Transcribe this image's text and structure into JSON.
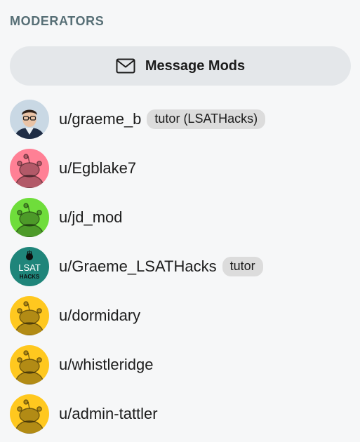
{
  "section": {
    "title": "MODERATORS"
  },
  "message_button": {
    "label": "Message Mods",
    "icon": "mail-icon"
  },
  "moderators": [
    {
      "username": "u/graeme_b",
      "flair": "tutor (LSATHacks)",
      "avatar": "photo",
      "avatar_color": "#c9d8e4"
    },
    {
      "username": "u/Egblake7",
      "flair": "",
      "avatar": "snoo",
      "avatar_color": "#ff8095"
    },
    {
      "username": "u/jd_mod",
      "flair": "",
      "avatar": "snoo",
      "avatar_color": "#6fdd3b"
    },
    {
      "username": "u/Graeme_LSATHacks",
      "flair": "tutor",
      "avatar": "logo",
      "avatar_color": "#1f857a",
      "logo_text_top": "LSAT",
      "logo_text_bottom": "HACKS"
    },
    {
      "username": "u/dormidary",
      "flair": "",
      "avatar": "snoo",
      "avatar_color": "#ffc81f"
    },
    {
      "username": "u/whistleridge",
      "flair": "",
      "avatar": "snoo",
      "avatar_color": "#ffc81f"
    },
    {
      "username": "u/admin-tattler",
      "flair": "",
      "avatar": "snoo",
      "avatar_color": "#ffc81f"
    }
  ]
}
